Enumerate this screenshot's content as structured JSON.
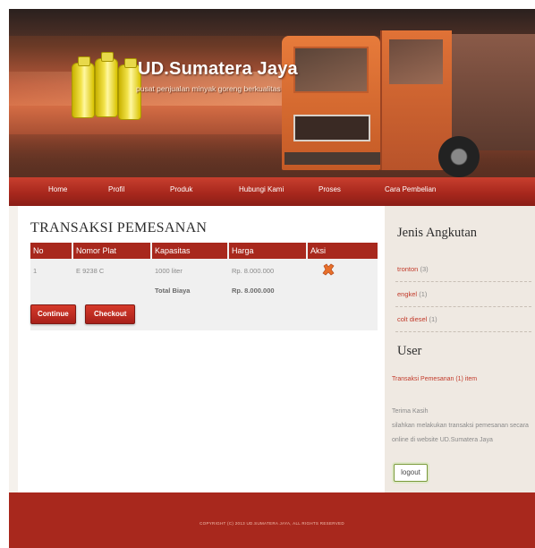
{
  "site": {
    "title": "UD.Sumatera Jaya",
    "tagline": "pusat penjualan minyak goreng berkualitas"
  },
  "nav": {
    "items": [
      "Home",
      "Profil",
      "Produk",
      "Hubungi Kami",
      "Proses",
      "Cara Pembelian"
    ]
  },
  "main": {
    "title": "TRANSAKSI PEMESANAN",
    "table": {
      "headers": [
        "No",
        "Nomor Plat",
        "Kapasitas",
        "Harga",
        "Aksi"
      ],
      "rows": [
        {
          "no": "1",
          "plate": "E 9238 C",
          "capacity": "1000 liter",
          "price": "Rp. 8.000.000"
        }
      ],
      "total_label": "Total Biaya",
      "total_value": "Rp. 8.000.000"
    },
    "buttons": {
      "continue": "Continue",
      "checkout": "Checkout"
    }
  },
  "sidebar": {
    "categories_title": "Jenis Angkutan",
    "categories": [
      {
        "label": "tronton",
        "count": "(3)"
      },
      {
        "label": "engkel",
        "count": "(1)"
      },
      {
        "label": "colt diesel",
        "count": "(1)"
      }
    ],
    "user_title": "User",
    "orders_link": "Transaksi Pemesanan (1) item",
    "message_line1": "Terima Kasih",
    "message_line2": "silahkan melakukan transaksi pemesanan secara",
    "message_line3": "online di website UD.Sumatera Jaya",
    "logout": "logout"
  },
  "footer": {
    "copyright": "COPYRIGHT (C) 2013 UD.SUMATERA JAYA, ALL RIGHTS RESERVED"
  },
  "colors": {
    "accent": "#a8281d",
    "link": "#c23a2a",
    "sidebar_bg": "#efe9e2"
  }
}
